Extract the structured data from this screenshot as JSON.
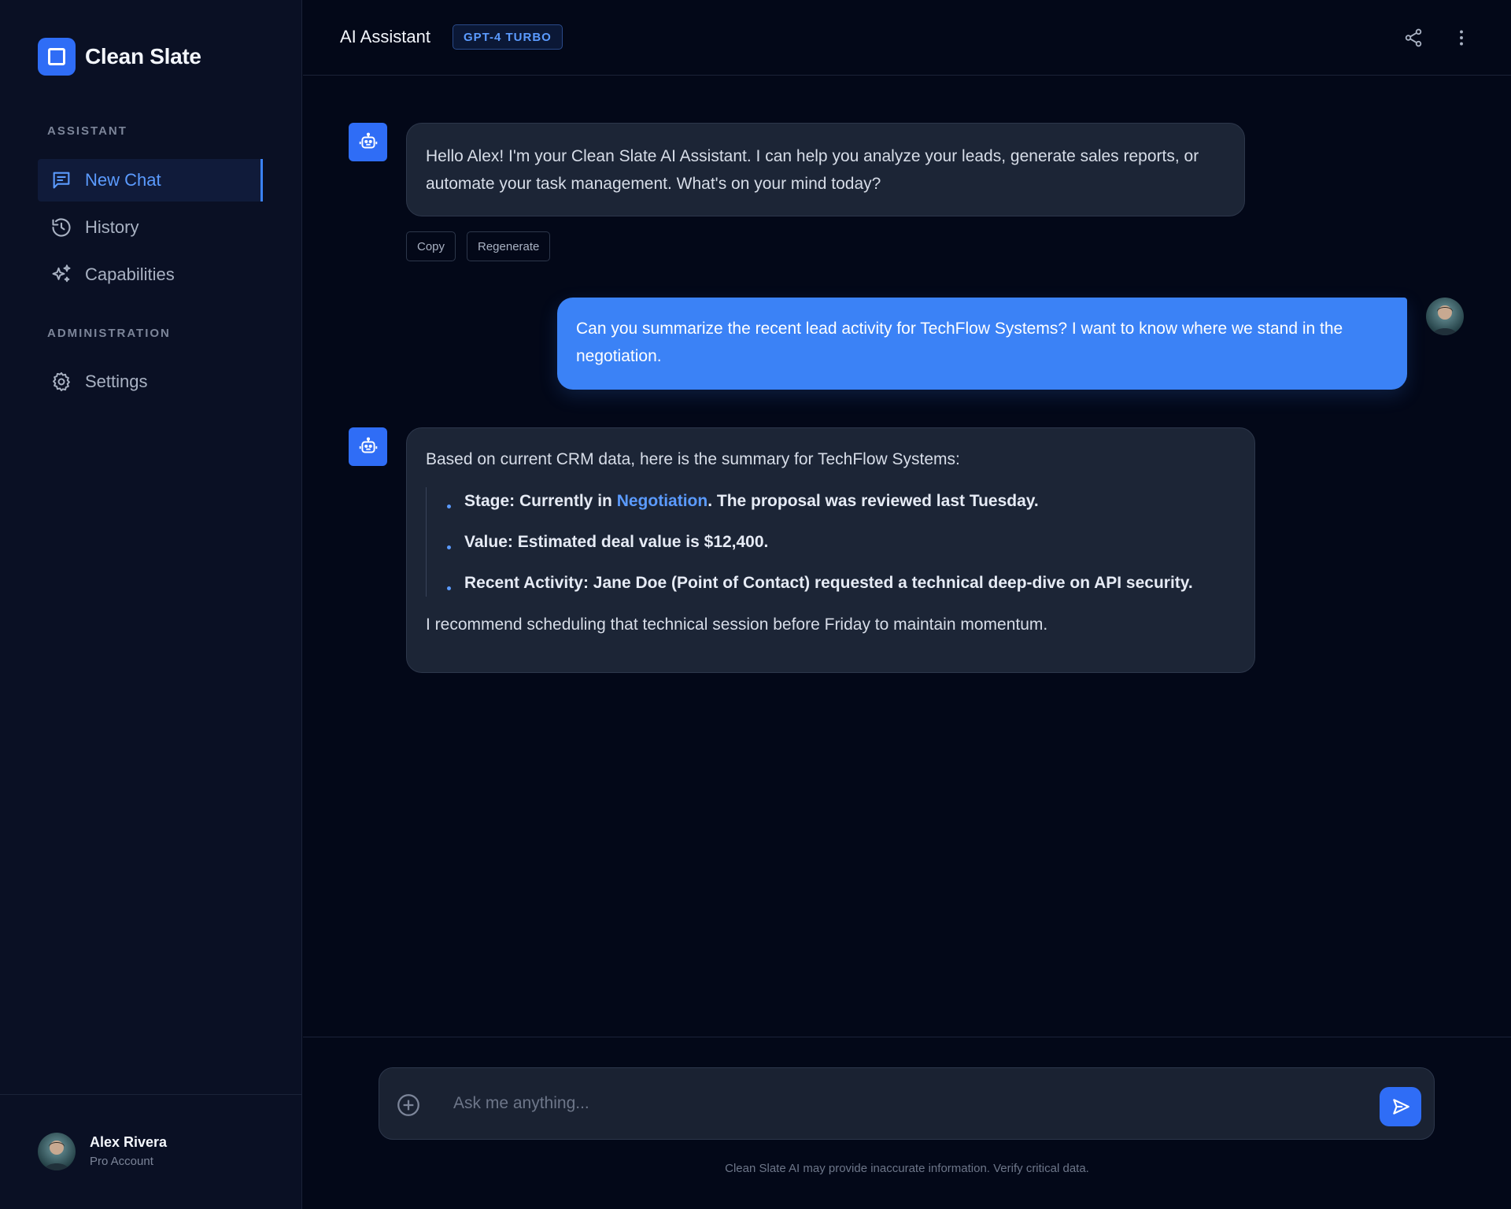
{
  "sidebar": {
    "brand_name": "Clean Slate",
    "sections": [
      {
        "label": "ASSISTANT",
        "items": [
          {
            "label": "New Chat",
            "icon": "chat-icon",
            "active": true
          },
          {
            "label": "History",
            "icon": "history-icon",
            "active": false
          },
          {
            "label": "Capabilities",
            "icon": "sparkles-icon",
            "active": false
          }
        ]
      },
      {
        "label": "ADMINISTRATION",
        "items": [
          {
            "label": "Settings",
            "icon": "gear-icon",
            "active": false
          }
        ]
      }
    ],
    "user": {
      "name": "Alex Rivera",
      "plan": "Pro Account"
    }
  },
  "header": {
    "title": "AI Assistant",
    "model_badge": "GPT-4 TURBO",
    "actions": [
      "share-icon",
      "more-vertical-icon"
    ]
  },
  "messages": [
    {
      "role": "assistant",
      "text": "Hello Alex! I'm your Clean Slate AI Assistant. I can help you analyze your leads, generate sales reports, or automate your task management. What's on your mind today?",
      "actions": [
        "Copy",
        "Regenerate"
      ]
    },
    {
      "role": "user",
      "text": "Can you summarize the recent lead activity for TechFlow Systems? I want to know where we stand in the negotiation."
    },
    {
      "role": "assistant",
      "intro": "Based on current CRM data, here is the summary for TechFlow Systems:",
      "bullets": [
        {
          "before": "Stage: Currently in ",
          "highlight": "Negotiation",
          "after": ". The proposal was reviewed last Tuesday."
        },
        {
          "before": "Value: Estimated deal value is $12,400.",
          "highlight": "",
          "after": ""
        },
        {
          "before": "Recent Activity: Jane Doe (Point of Contact) requested a technical deep-dive on API security.",
          "highlight": "",
          "after": ""
        }
      ],
      "outro": "I recommend scheduling that technical session before Friday to maintain momentum."
    }
  ],
  "composer": {
    "placeholder": "Ask me anything...",
    "value": "",
    "disclaimer": "Clean Slate AI may provide inaccurate information. Verify critical data."
  },
  "colors": {
    "accent": "#3b82f6",
    "background": "#030818",
    "sidebar": "#0a1024",
    "bot_bubble": "#1c2536"
  }
}
